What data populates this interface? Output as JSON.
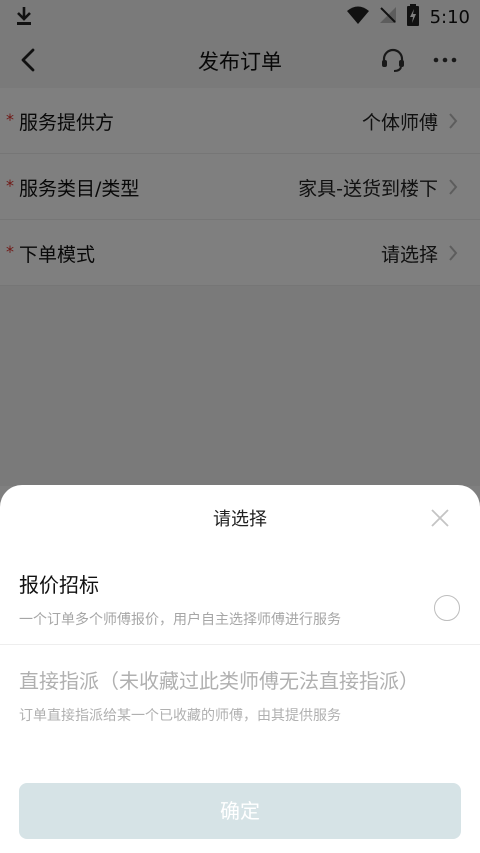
{
  "status_bar": {
    "time": "5:10",
    "icons": [
      "download-icon",
      "wifi-icon",
      "no-signal-icon",
      "battery-charging-icon"
    ]
  },
  "nav": {
    "title": "发布订单",
    "back_icon": "back-chevron-icon",
    "support_icon": "headset-icon",
    "more_icon": "more-dots-icon"
  },
  "form": {
    "rows": [
      {
        "required": "*",
        "label": "服务提供方",
        "value": "个体师傅"
      },
      {
        "required": "*",
        "label": "服务类目/类型",
        "value": "家具-送货到楼下"
      },
      {
        "required": "*",
        "label": "下单模式",
        "value": "请选择"
      }
    ]
  },
  "sheet": {
    "title": "请选择",
    "options": [
      {
        "title": "报价招标",
        "desc": "一个订单多个师傅报价，用户自主选择师傅进行服务",
        "enabled": true
      },
      {
        "title": "直接指派（未收藏过此类师傅无法直接指派）",
        "desc": "订单直接指派给某一个已收藏的师傅，由其提供服务",
        "enabled": false
      }
    ],
    "confirm_label": "确定"
  },
  "colors": {
    "required_star": "#e0302a",
    "confirm_disabled_bg": "#d6e3e6",
    "overlay": "rgba(0,0,0,0.5)"
  }
}
